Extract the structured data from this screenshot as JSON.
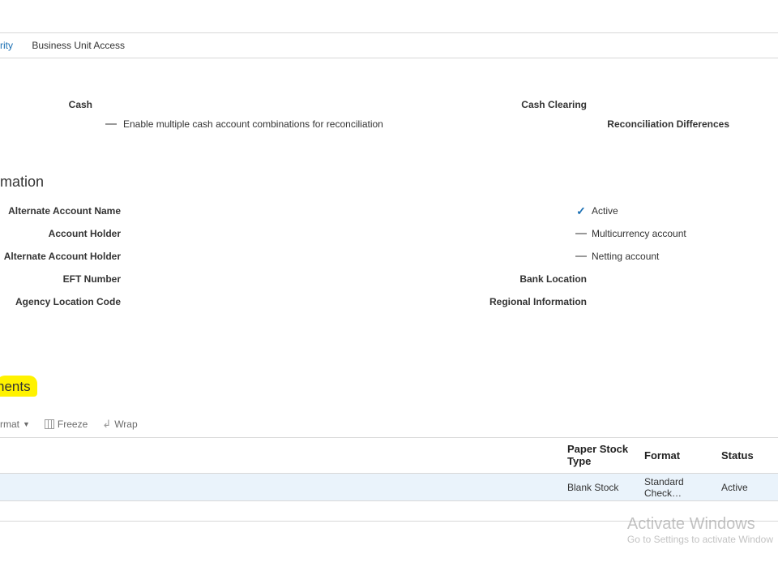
{
  "tabs": {
    "left_partial": "rity",
    "businessunit": "Business Unit Access"
  },
  "cash_section": {
    "cash_label": "Cash",
    "cash_clearing_label": "Cash Clearing",
    "enable_multi": "Enable multiple cash account combinations for reconciliation",
    "recon_diff_label": "Reconciliation Differences"
  },
  "info_section": {
    "heading_partial": "mation",
    "left_labels": {
      "alt_acct_name": "Alternate Account Name",
      "acct_holder": "Account Holder",
      "alt_acct_holder": "Alternate Account Holder",
      "eft_number": "EFT Number",
      "agency_loc_code": "Agency Location Code"
    },
    "right": {
      "active": "Active",
      "multicurrency": "Multicurrency account",
      "netting": "Netting account",
      "bank_location": "Bank Location",
      "regional_info": "Regional Information"
    }
  },
  "highlight_tab_partial": "nents",
  "toolbar": {
    "format": "rmat",
    "freeze": "Freeze",
    "wrap": "Wrap"
  },
  "table": {
    "headers": {
      "paper_stock_type": "Paper Stock Type",
      "format": "Format",
      "status": "Status"
    },
    "rows": [
      {
        "paper_stock_type": "Blank Stock",
        "format": "Standard Check…",
        "status": "Active"
      }
    ]
  },
  "watermark": {
    "line1": "Activate Windows",
    "line2": "Go to Settings to activate Window"
  }
}
